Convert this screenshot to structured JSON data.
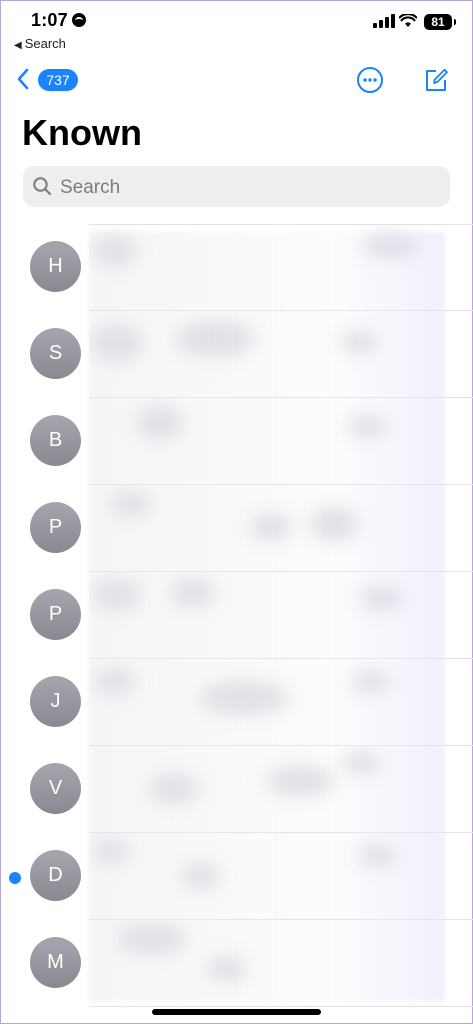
{
  "status_bar": {
    "time": "1:07",
    "battery": "81"
  },
  "back_app": {
    "label": "Search"
  },
  "nav": {
    "unread_count": "737"
  },
  "page": {
    "title": "Known"
  },
  "search": {
    "placeholder": "Search"
  },
  "messages": [
    {
      "initial": "H",
      "unread": false
    },
    {
      "initial": "S",
      "unread": false
    },
    {
      "initial": "B",
      "unread": false
    },
    {
      "initial": "P",
      "unread": false
    },
    {
      "initial": "P",
      "unread": false
    },
    {
      "initial": "J",
      "unread": false
    },
    {
      "initial": "V",
      "unread": false
    },
    {
      "initial": "D",
      "unread": true
    },
    {
      "initial": "M",
      "unread": false
    }
  ],
  "colors": {
    "accent": "#1a84ff",
    "avatar": "#989aa2",
    "search_bg": "#eeeef0"
  }
}
